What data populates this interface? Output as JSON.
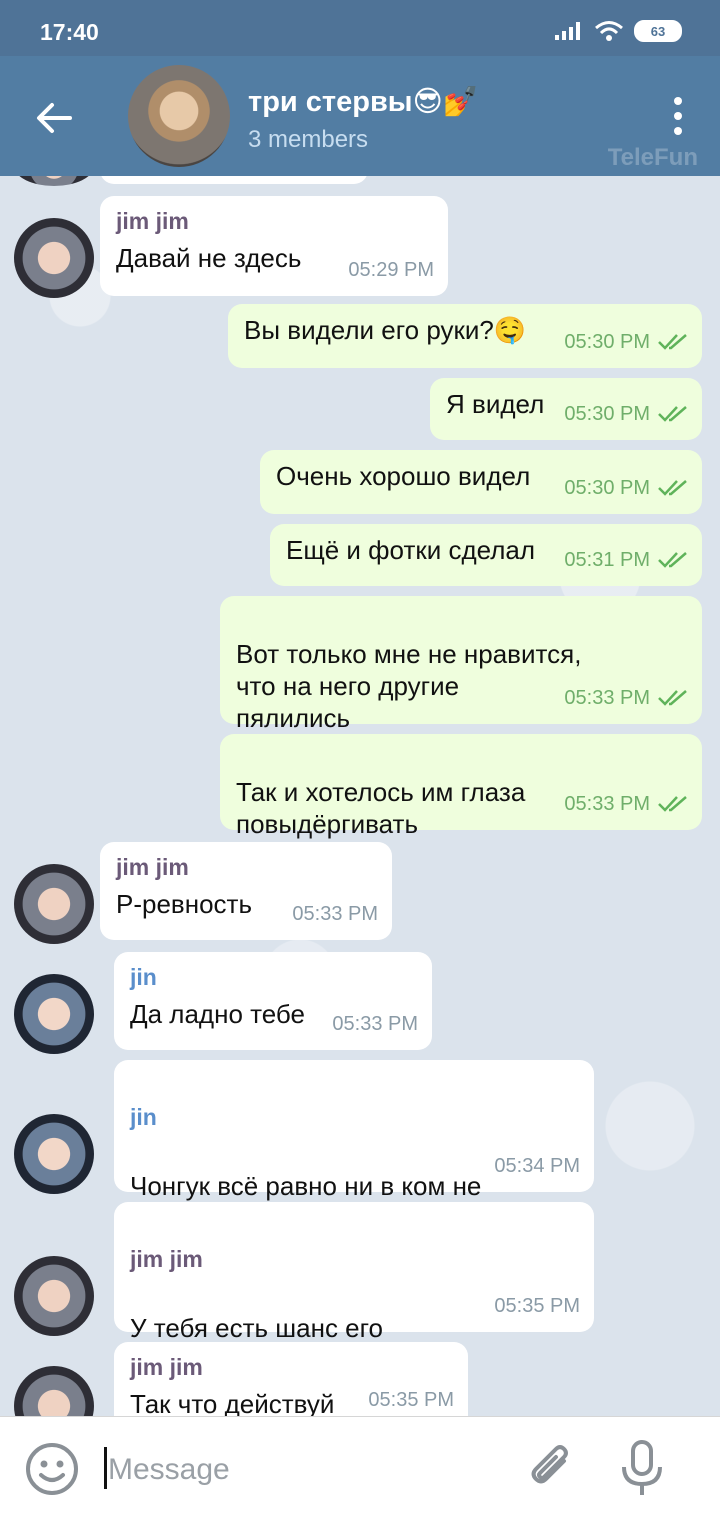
{
  "status_bar": {
    "time": "17:40",
    "battery": "63"
  },
  "header": {
    "title": "три стервы😎💅",
    "subtitle": "3 members",
    "watermark": "TeleFun"
  },
  "messages": [
    {
      "sender": "jim jim",
      "text": "Давай не здесь",
      "time": "05:29 PM"
    },
    {
      "text": "Вы видели его руки?🤤",
      "time": "05:30 PM"
    },
    {
      "text": "Я видел",
      "time": "05:30 PM"
    },
    {
      "text": "Очень хорошо видел",
      "time": "05:30 PM"
    },
    {
      "text": "Ещё и фотки сделал",
      "time": "05:31 PM"
    },
    {
      "text": "Вот только мне не нравится,\nчто на него другие\nпялились",
      "time": "05:33 PM"
    },
    {
      "text": "Так и хотелось им глаза\nповыдёргивать",
      "time": "05:33 PM"
    },
    {
      "sender": "jim jim",
      "text": "Р-ревность",
      "time": "05:33 PM"
    },
    {
      "sender": "jin",
      "text": "Да ладно тебе",
      "time": "05:33 PM"
    },
    {
      "sender": "jin",
      "text": "Чонгук всё равно ни в ком не\nзаинтересован",
      "time": "05:34 PM"
    },
    {
      "sender": "jim jim",
      "text": "У тебя есть шанс его\nпривлечь",
      "time": "05:35 PM"
    },
    {
      "sender": "jim jim",
      "text": "Так что действуй",
      "time": "05:35 PM"
    }
  ],
  "input": {
    "placeholder": "Message"
  },
  "colors": {
    "header": "#527da3",
    "status_bar": "#4f7397",
    "outgoing_bubble": "#effedd",
    "incoming_bubble": "#ffffff",
    "read_checks": "#5fb35a"
  }
}
